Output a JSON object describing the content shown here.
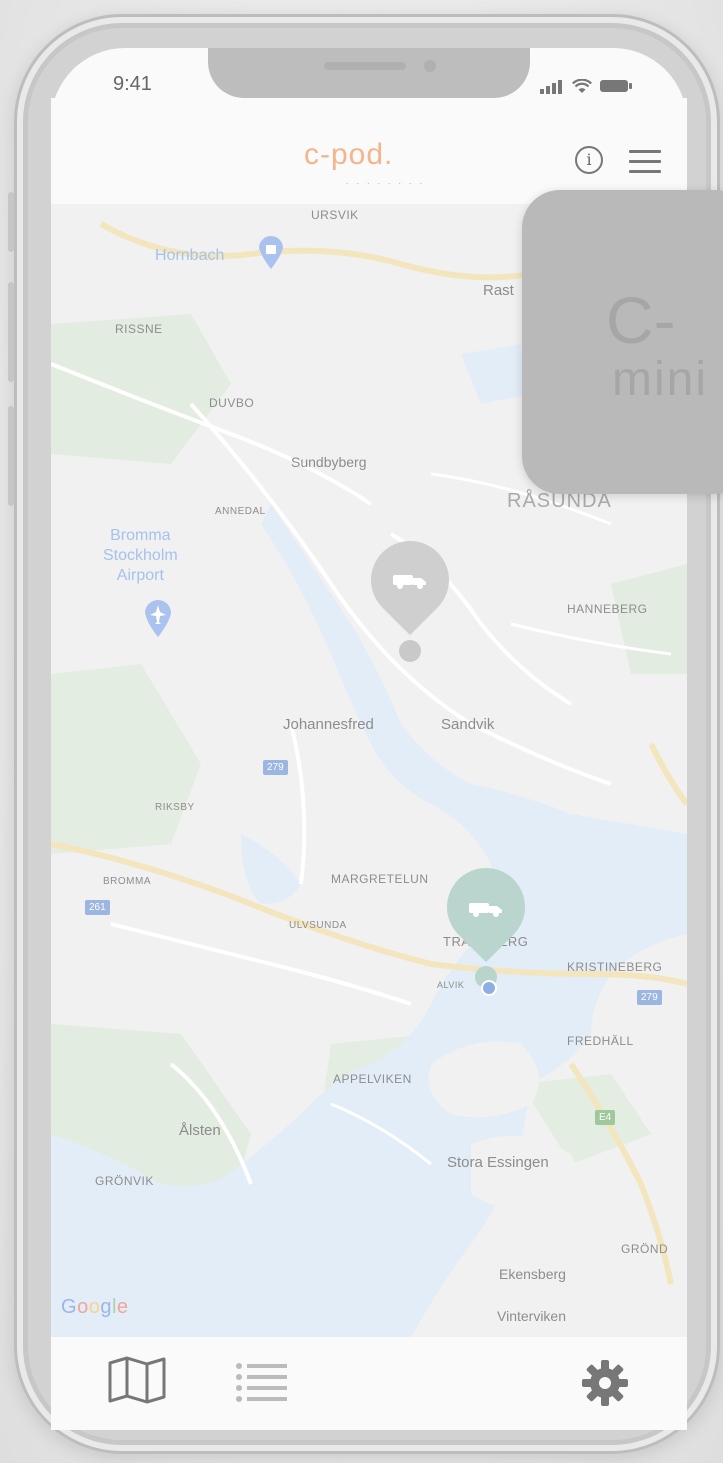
{
  "status": {
    "time": "9:41"
  },
  "header": {
    "logo_text": "c-pod.",
    "logo_dots": "........",
    "info_glyph": "i"
  },
  "map": {
    "labels": {
      "ursvik": "URSVIK",
      "hornbach": "Hornbach",
      "rast": "Rast",
      "rissne": "RISSNE",
      "duvbo": "DUVBO",
      "sundbyberg": "Sundbyberg",
      "annedal": "ANNEDAL",
      "rasunda": "RÅSUNDA",
      "bromma": "Bromma\nStockholm\nAirport",
      "hanneberg": "HANNEBERG",
      "johannesfred": "Johannesfred",
      "sandvik": "Sandvik",
      "riksby": "RIKSBY",
      "bromma_small": "BROMMA",
      "margretelund": "MARGRETELUN",
      "traneberg": "TRANEBERG",
      "ulvsunda": "ULVSUNDA",
      "alvik": "ALVIK",
      "kristineberg": "KRISTINEBERG",
      "fredhall": "FREDHÄLL",
      "appelviken": "APPELVIKEN",
      "alsten": "Ålsten",
      "gronvik": "GRÖNVIK",
      "stora_essingen": "Stora Essingen",
      "grond": "GRÖND",
      "ekensberg": "Ekensberg",
      "vinterviken": "Vinterviken"
    },
    "road_numbers": {
      "r279a": "279",
      "r261": "261",
      "r279b": "279",
      "r4": "E4"
    },
    "google": [
      "G",
      "o",
      "o",
      "g",
      "l",
      "e"
    ],
    "google_colors": [
      "#9cb6e8",
      "#f0a59e",
      "#f5d58a",
      "#9cb6e8",
      "#a9d3ac",
      "#f0a59e"
    ]
  },
  "card": {
    "line1": "C-",
    "line2": "mini"
  },
  "tabs": {
    "map_label": "map",
    "list_label": "list",
    "settings_label": "settings"
  },
  "colors": {
    "accent": "#f2b58c",
    "map_water": "#e3edf7",
    "map_park": "#e2ece0"
  }
}
